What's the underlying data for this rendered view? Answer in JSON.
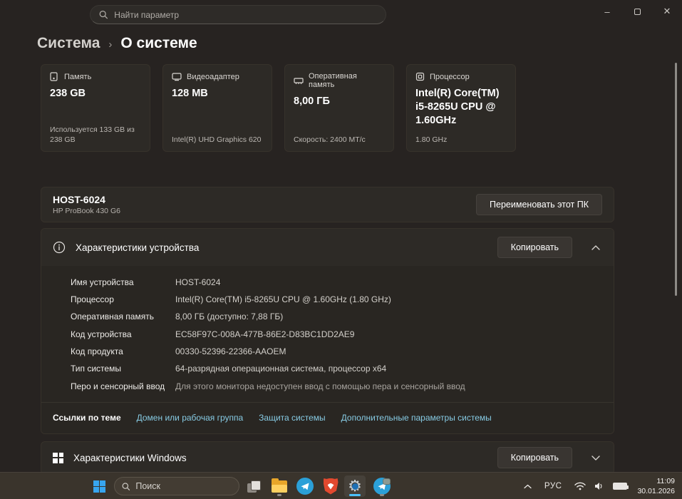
{
  "titlebar": {
    "search_placeholder": "Найти параметр",
    "minimize_glyph": "–",
    "close_glyph": "✕"
  },
  "breadcrumb": {
    "root": "Система",
    "separator": "›",
    "current": "О системе"
  },
  "cards": [
    {
      "icon": "storage-icon",
      "label": "Память",
      "value": "238 GB",
      "detail": "Используется 133 GB из 238 GB"
    },
    {
      "icon": "gpu-icon",
      "label": "Видеоадаптер",
      "value": "128 MB",
      "detail": "Intel(R) UHD Graphics 620"
    },
    {
      "icon": "ram-icon",
      "label": "Оперативная память",
      "value": "8,00 ГБ",
      "detail": "Скорость: 2400 МТ/с"
    },
    {
      "icon": "cpu-icon",
      "label": "Процессор",
      "value": "Intel(R) Core(TM) i5-8265U CPU @ 1.60GHz",
      "detail": "1.80 GHz"
    }
  ],
  "device": {
    "name": "HOST-6024",
    "model": "HP ProBook 430 G6",
    "rename_button": "Переименовать этот ПК"
  },
  "specs": {
    "title": "Характеристики устройства",
    "copy_button": "Копировать",
    "rows": [
      {
        "label": "Имя устройства",
        "value": "HOST-6024"
      },
      {
        "label": "Процессор",
        "value": "Intel(R) Core(TM) i5-8265U CPU @ 1.60GHz (1.80 GHz)"
      },
      {
        "label": "Оперативная память",
        "value": "8,00 ГБ (доступно: 7,88 ГБ)"
      },
      {
        "label": "Код устройства",
        "value": "EC58F97C-008A-477B-86E2-D83BC1DD2AE9"
      },
      {
        "label": "Код продукта",
        "value": "00330-52396-22366-AAOEM"
      },
      {
        "label": "Тип системы",
        "value": "64-разрядная операционная система, процессор x64"
      },
      {
        "label": "Перо и сенсорный ввод",
        "value": "Для этого монитора недоступен ввод с помощью пера и сенсорный ввод"
      }
    ],
    "related": {
      "label": "Ссылки по теме",
      "links": [
        "Домен или рабочая группа",
        "Защита системы",
        "Дополнительные параметры системы"
      ]
    }
  },
  "windows_features": {
    "title": "Характеристики Windows",
    "copy_button": "Копировать"
  },
  "taskbar": {
    "search_placeholder": "Поиск",
    "language": "РУС",
    "time": "11:09",
    "date": "30.01.2026"
  },
  "icons": {
    "settings_gear": "⚙",
    "search": "magnifier",
    "info": "circled-i"
  },
  "colors": {
    "accent": "#4cc2ff",
    "link": "#87cbe4",
    "start_blue": "#37a5f0",
    "telegram": "#2ba0d8",
    "brave": "#e2492f",
    "folder": "#ffd161",
    "card_bg": "#2d2a26",
    "page_bg": "#272321",
    "taskbar_bg": "#3a342c"
  }
}
